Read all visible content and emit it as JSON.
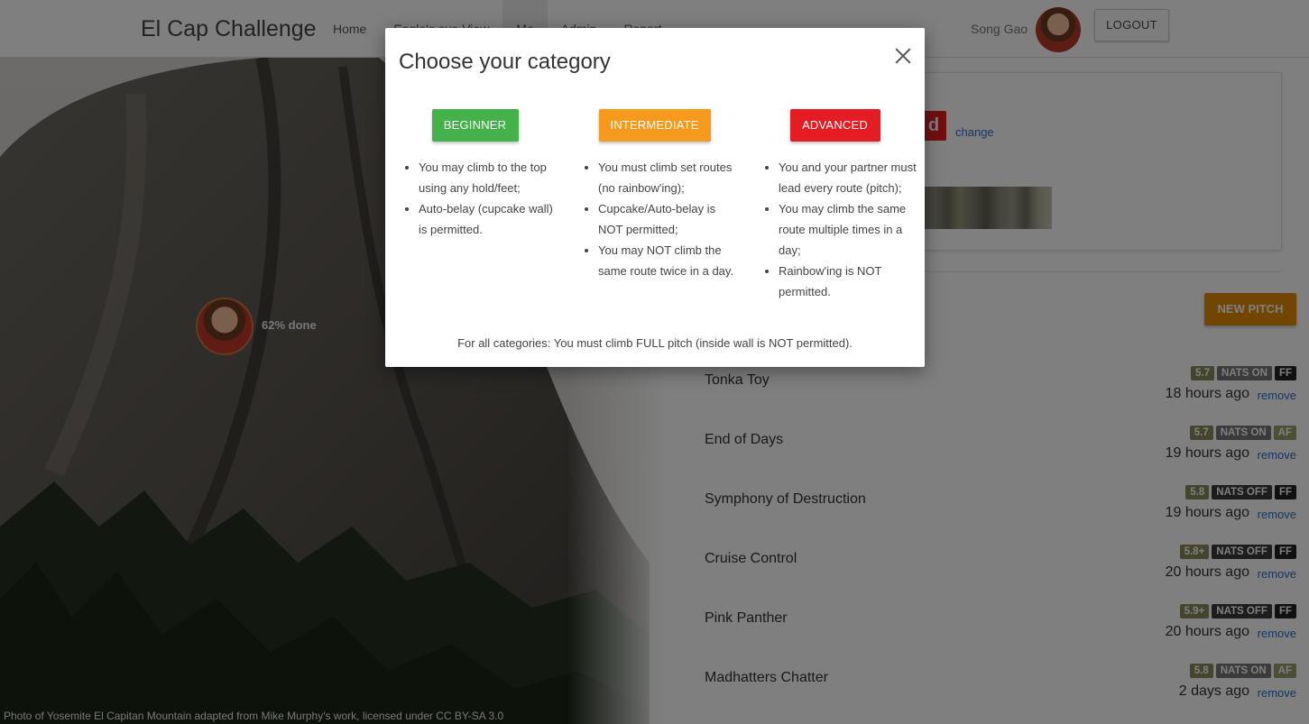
{
  "navbar": {
    "brand": "El Cap Challenge",
    "links": [
      "Home",
      "Eagle's eye View",
      "Me",
      "Admin",
      "Report"
    ],
    "user_name": "Song Gao",
    "logout_label": "LOGOUT"
  },
  "photo": {
    "progress_label": "62% done",
    "credit": "Photo of Yosemite El Capitan Mountain adapted from Mike Murphy's work, licensed under CC BY-SA 3.0"
  },
  "status": {
    "category_letter": "d",
    "change_label": "change"
  },
  "new_pitch_label": "NEW PITCH",
  "pitches": [
    {
      "name": "Tonka Toy",
      "grade": "5.7",
      "nats": "NATS ON",
      "style": "FF",
      "time": "18 hours ago",
      "remove": "remove"
    },
    {
      "name": "End of Days",
      "grade": "5.7",
      "nats": "NATS ON",
      "style": "AF",
      "time": "19 hours ago",
      "remove": "remove"
    },
    {
      "name": "Symphony of Destruction",
      "grade": "5.8",
      "nats": "NATS OFF",
      "style": "FF",
      "time": "19 hours ago",
      "remove": "remove"
    },
    {
      "name": "Cruise Control",
      "grade": "5.8+",
      "nats": "NATS OFF",
      "style": "FF",
      "time": "20 hours ago",
      "remove": "remove"
    },
    {
      "name": "Pink Panther",
      "grade": "5.9+",
      "nats": "NATS OFF",
      "style": "FF",
      "time": "20 hours ago",
      "remove": "remove"
    },
    {
      "name": "Madhatters Chatter",
      "grade": "5.8",
      "nats": "NATS ON",
      "style": "AF",
      "time": "2 days ago",
      "remove": "remove"
    }
  ],
  "modal": {
    "title": "Choose your category",
    "close_icon": "close-icon",
    "categories": [
      {
        "label": "BEGINNER",
        "color": "#44b14b",
        "rules": [
          "You may climb to the top using any hold/feet;",
          "Auto-belay (cupcake wall) is permitted."
        ]
      },
      {
        "label": "INTERMEDIATE",
        "color": "#f59a1c",
        "rules": [
          "You must climb set routes (no rainbow'ing);",
          "Cupcake/Auto-belay is NOT permitted;",
          "You may NOT climb the same route twice in a day."
        ]
      },
      {
        "label": "ADVANCED",
        "color": "#e51c23",
        "rules": [
          "You and your partner must lead every route (pitch);",
          "You may climb the same route multiple times in a day;",
          "Rainbow'ing is NOT permitted."
        ]
      }
    ],
    "footer_note": "For all categories: You must climb FULL pitch (inside wall is NOT permitted)."
  }
}
